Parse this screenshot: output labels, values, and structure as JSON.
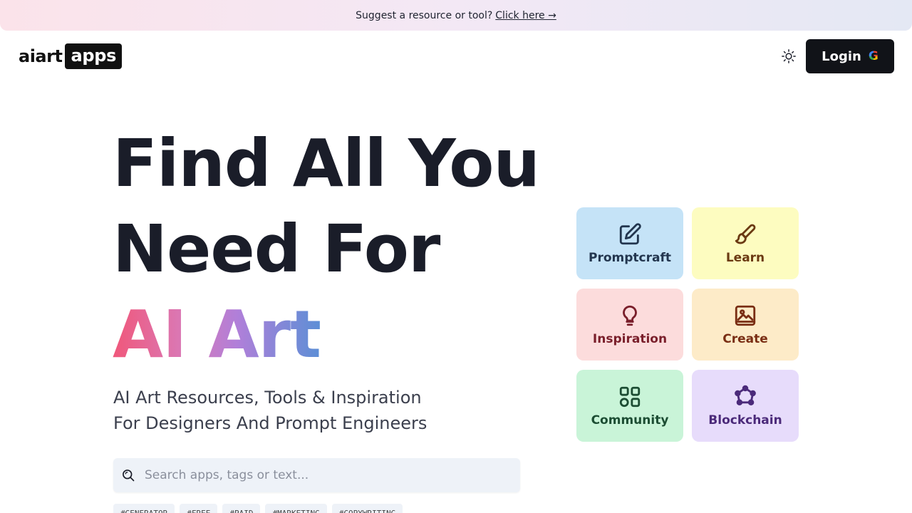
{
  "banner": {
    "text": "Suggest a resource or tool?",
    "link": "Click here →"
  },
  "logo": {
    "part1": "aiart",
    "part2": "apps"
  },
  "header": {
    "login_label": "Login",
    "google_glyph": "G",
    "theme_icon": "sun-icon"
  },
  "hero": {
    "line1": "Find All You",
    "line2": "Need For",
    "line3": "AI Art",
    "subtitle_line1": "AI Art Resources, Tools & Inspiration",
    "subtitle_line2": "For Designers And Prompt Engineers"
  },
  "search": {
    "placeholder": "Search apps, tags or text...",
    "value": ""
  },
  "tags": [
    "#GENERATOR",
    "#FREE",
    "#PAID",
    "#MARKETING",
    "#COPYWRITING"
  ],
  "categories": [
    {
      "label": "Promptcraft",
      "icon": "pencil-square-icon",
      "bg": "#c5e3f7",
      "fg": "#23364f"
    },
    {
      "label": "Learn",
      "icon": "paintbrush-icon",
      "bg": "#fdfcc0",
      "fg": "#6b3a12"
    },
    {
      "label": "Inspiration",
      "icon": "lightbulb-icon",
      "bg": "#fcdcdc",
      "fg": "#7a1f2b"
    },
    {
      "label": "Create",
      "icon": "image-icon",
      "bg": "#fdebc8",
      "fg": "#7a2e14"
    },
    {
      "label": "Community",
      "icon": "shapes-icon",
      "bg": "#c9f4d8",
      "fg": "#1c4d33"
    },
    {
      "label": "Blockchain",
      "icon": "network-icon",
      "bg": "#e7dcfb",
      "fg": "#4b2a7a"
    }
  ]
}
